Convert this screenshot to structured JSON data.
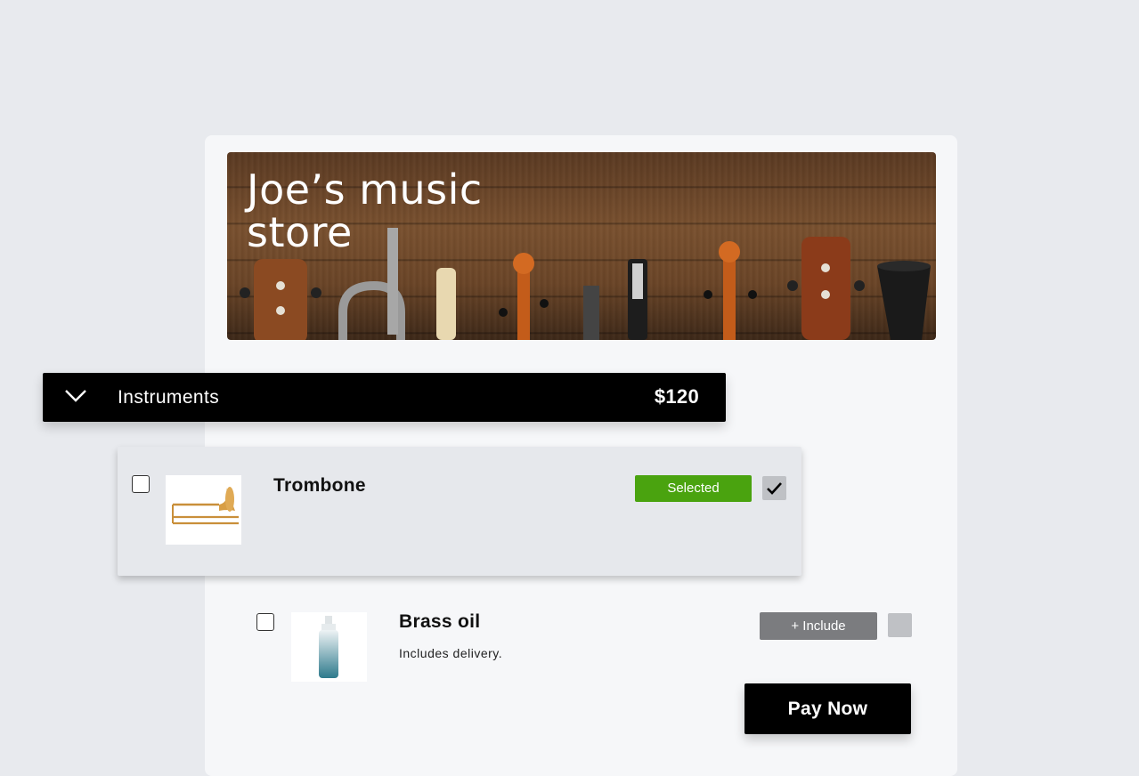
{
  "store": {
    "title": "Joe’s music store"
  },
  "category": {
    "label": "Instruments",
    "total": "$120",
    "icon": "chevron-down-icon"
  },
  "items": [
    {
      "name": "Trombone",
      "description": "",
      "status": "Selected",
      "checked": true
    },
    {
      "name": "Brass oil",
      "description": "Includes delivery.",
      "action": "+ Include",
      "checked": false
    }
  ],
  "checkout": {
    "pay_label": "Pay Now"
  },
  "colors": {
    "selected": "#4aa30f",
    "include": "#7b7c7f",
    "bar": "#000000",
    "background": "#e8eaee"
  }
}
